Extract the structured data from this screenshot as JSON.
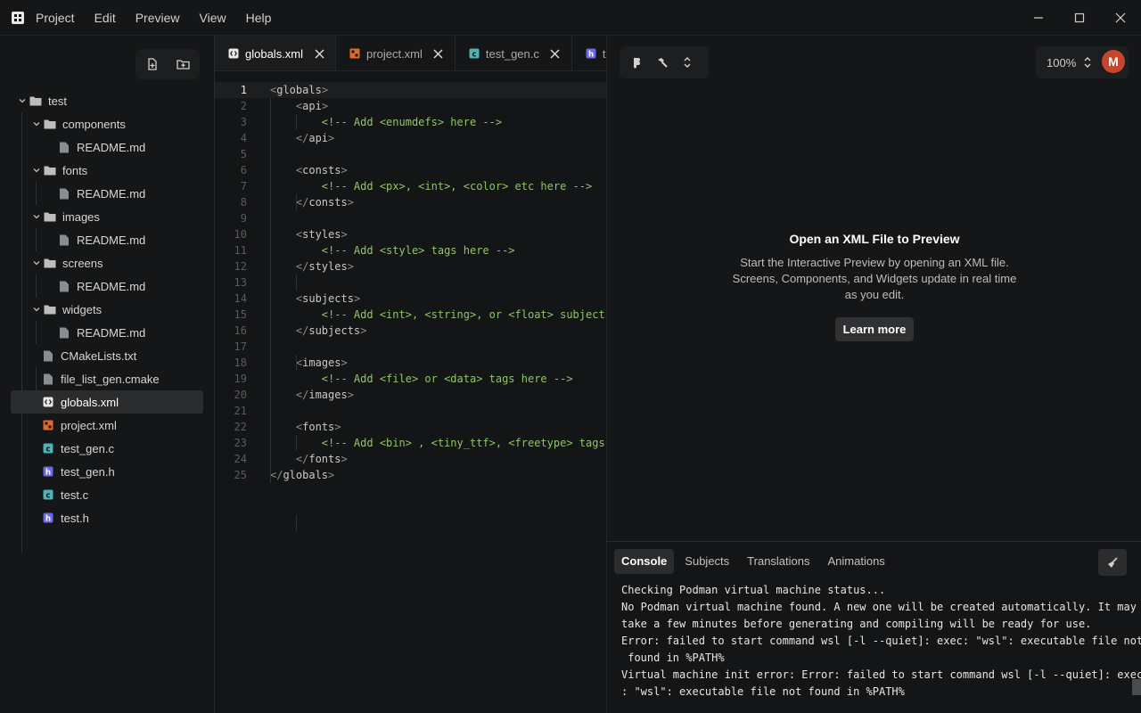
{
  "menu": {
    "items": [
      "Project",
      "Edit",
      "Preview",
      "View",
      "Help"
    ]
  },
  "sidebar": {
    "actions": [
      {
        "name": "new-file-icon"
      },
      {
        "name": "new-folder-icon"
      }
    ],
    "tree": [
      {
        "label": "test",
        "type": "folder",
        "depth": 0
      },
      {
        "label": "components",
        "type": "folder",
        "depth": 1
      },
      {
        "label": "README.md",
        "type": "file",
        "depth": 2
      },
      {
        "label": "fonts",
        "type": "folder",
        "depth": 1
      },
      {
        "label": "README.md",
        "type": "file",
        "depth": 2
      },
      {
        "label": "images",
        "type": "folder",
        "depth": 1
      },
      {
        "label": "README.md",
        "type": "file",
        "depth": 2
      },
      {
        "label": "screens",
        "type": "folder",
        "depth": 1
      },
      {
        "label": "README.md",
        "type": "file",
        "depth": 2
      },
      {
        "label": "widgets",
        "type": "folder",
        "depth": 1
      },
      {
        "label": "README.md",
        "type": "file",
        "depth": 2
      },
      {
        "label": "CMakeLists.txt",
        "type": "file",
        "depth": 1
      },
      {
        "label": "file_list_gen.cmake",
        "type": "file",
        "depth": 1
      },
      {
        "label": "globals.xml",
        "type": "xml-globals",
        "depth": 1,
        "selected": true
      },
      {
        "label": "project.xml",
        "type": "xml-project",
        "depth": 1
      },
      {
        "label": "test_gen.c",
        "type": "c",
        "depth": 1
      },
      {
        "label": "test_gen.h",
        "type": "h",
        "depth": 1
      },
      {
        "label": "test.c",
        "type": "c",
        "depth": 1
      },
      {
        "label": "test.h",
        "type": "h",
        "depth": 1
      }
    ]
  },
  "editor": {
    "tabs": [
      {
        "label": "globals.xml",
        "type": "xml-globals",
        "active": true
      },
      {
        "label": "project.xml",
        "type": "xml-project"
      },
      {
        "label": "test_gen.c",
        "type": "c"
      },
      {
        "label": "te",
        "type": "h"
      }
    ],
    "current_line": 1,
    "lines": [
      [
        [
          "p",
          "<"
        ],
        [
          "t",
          "globals"
        ],
        [
          "p",
          ">"
        ]
      ],
      [
        [
          "i",
          "    "
        ],
        [
          "p",
          "<"
        ],
        [
          "t",
          "api"
        ],
        [
          "p",
          ">"
        ]
      ],
      [
        [
          "i",
          "        "
        ],
        [
          "c",
          "<!-- Add <enumdefs> here -->"
        ]
      ],
      [
        [
          "i",
          "    "
        ],
        [
          "p",
          "</"
        ],
        [
          "t",
          "api"
        ],
        [
          "p",
          ">"
        ]
      ],
      [],
      [
        [
          "i",
          "    "
        ],
        [
          "p",
          "<"
        ],
        [
          "t",
          "consts"
        ],
        [
          "p",
          ">"
        ]
      ],
      [
        [
          "i",
          "        "
        ],
        [
          "c",
          "<!-- Add <px>, <int>, <color> etc here -->"
        ]
      ],
      [
        [
          "i",
          "    "
        ],
        [
          "p",
          "</"
        ],
        [
          "t",
          "consts"
        ],
        [
          "p",
          ">"
        ]
      ],
      [],
      [
        [
          "i",
          "    "
        ],
        [
          "p",
          "<"
        ],
        [
          "t",
          "styles"
        ],
        [
          "p",
          ">"
        ]
      ],
      [
        [
          "i",
          "        "
        ],
        [
          "c",
          "<!-- Add <style> tags here -->"
        ]
      ],
      [
        [
          "i",
          "    "
        ],
        [
          "p",
          "</"
        ],
        [
          "t",
          "styles"
        ],
        [
          "p",
          ">"
        ]
      ],
      [],
      [
        [
          "i",
          "    "
        ],
        [
          "p",
          "<"
        ],
        [
          "t",
          "subjects"
        ],
        [
          "p",
          ">"
        ]
      ],
      [
        [
          "i",
          "        "
        ],
        [
          "c",
          "<!-- Add <int>, <string>, or <float> subjects"
        ]
      ],
      [
        [
          "i",
          "    "
        ],
        [
          "p",
          "</"
        ],
        [
          "t",
          "subjects"
        ],
        [
          "p",
          ">"
        ]
      ],
      [],
      [
        [
          "i",
          "    "
        ],
        [
          "p",
          "<"
        ],
        [
          "t",
          "images"
        ],
        [
          "p",
          ">"
        ]
      ],
      [
        [
          "i",
          "        "
        ],
        [
          "c",
          "<!-- Add <file> or <data> tags here -->"
        ]
      ],
      [
        [
          "i",
          "    "
        ],
        [
          "p",
          "</"
        ],
        [
          "t",
          "images"
        ],
        [
          "p",
          ">"
        ]
      ],
      [],
      [
        [
          "i",
          "    "
        ],
        [
          "p",
          "<"
        ],
        [
          "t",
          "fonts"
        ],
        [
          "p",
          ">"
        ]
      ],
      [
        [
          "i",
          "        "
        ],
        [
          "c",
          "<!-- Add <bin> , <tiny_ttf>, <freetype> tags"
        ]
      ],
      [
        [
          "i",
          "    "
        ],
        [
          "p",
          "</"
        ],
        [
          "t",
          "fonts"
        ],
        [
          "p",
          ">"
        ]
      ],
      [
        [
          "p",
          "</"
        ],
        [
          "t",
          "globals"
        ],
        [
          "p",
          ">"
        ]
      ]
    ]
  },
  "preview": {
    "zoom": "100%",
    "avatar_initial": "M",
    "empty_title": "Open an XML File to Preview",
    "empty_desc": "Start the Interactive Preview by opening an XML file. Screens, Components, and Widgets update in real time as you edit.",
    "learn_more": "Learn more"
  },
  "console": {
    "tabs": [
      "Console",
      "Subjects",
      "Translations",
      "Animations"
    ],
    "active_tab": 0,
    "lines": [
      "Checking Podman virtual machine status...",
      "No Podman virtual machine found. A new one will be created automatically. It may",
      "take a few minutes before generating and compiling will be ready for use.",
      "Error: failed to start command wsl [-l --quiet]: exec: \"wsl\": executable file not",
      " found in %PATH%",
      "Virtual machine init error: Error: failed to start command wsl [-l --quiet]: exec",
      ": \"wsl\": executable file not found in %PATH%"
    ]
  },
  "colors": {
    "background": "#141516",
    "tag": "#c9c9c9",
    "punct": "#8a8c8e",
    "comment": "#8fc56a",
    "accent_avatar": "#c7462b",
    "xml_globals_icon": "#e8e8e8",
    "xml_project_icon": "#e0692c",
    "c_icon": "#4fb3b3",
    "h_icon": "#6a6ae8"
  }
}
